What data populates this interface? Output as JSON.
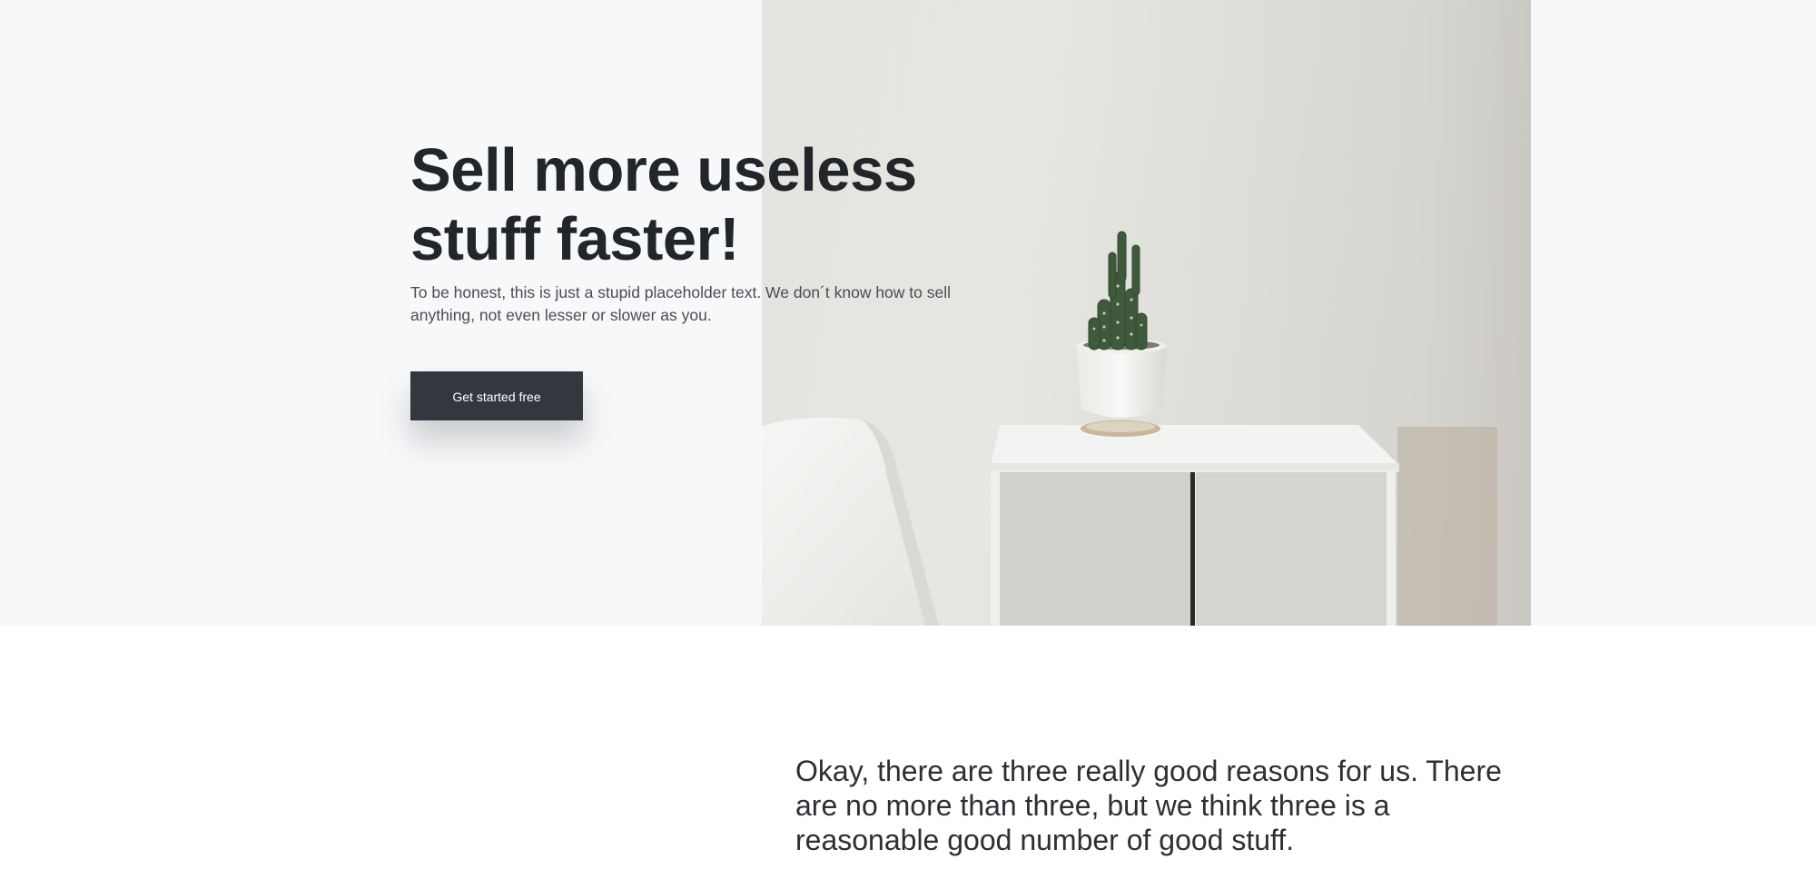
{
  "hero": {
    "title": "Sell more useless stuff faster!",
    "subtitle": "To be honest, this is just a stupid placeholder text. We don´t know how to sell anything, not even lesser or slower as you.",
    "cta_label": "Get started free",
    "image_icon": "photo-cactus-cabinet-chair"
  },
  "reasons": {
    "text": "Okay, there are three really good reasons for us. There are no more than three, but we think three is a reasonable good number of good stuff."
  },
  "colors": {
    "hero_background": "#f7f8fa",
    "heading": "#22252a",
    "button_background": "#33383f",
    "button_text": "#ffffff",
    "page_background": "#ffffff"
  }
}
